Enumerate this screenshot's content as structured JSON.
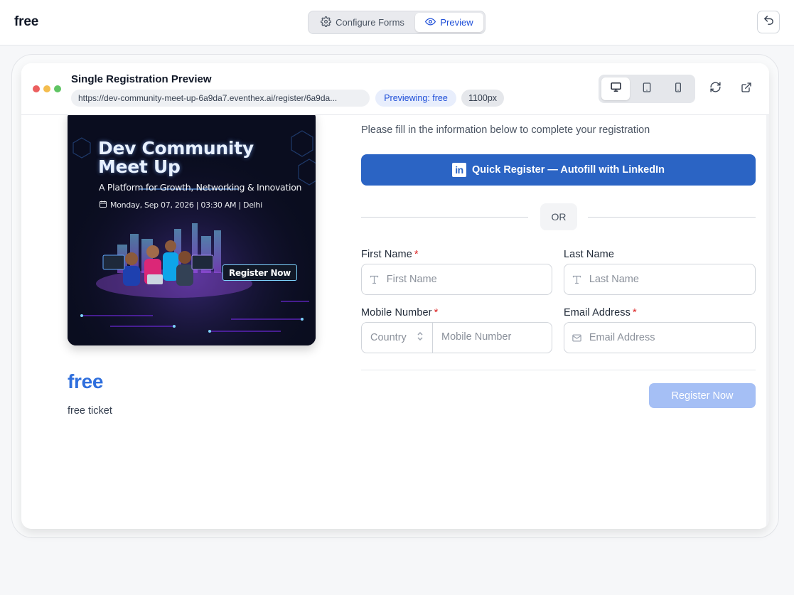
{
  "app": {
    "title": "free"
  },
  "mode_toggle": {
    "configure_label": "Configure Forms",
    "preview_label": "Preview",
    "active": "Preview"
  },
  "browser": {
    "title": "Single Registration Preview",
    "url": "https://dev-community-meet-up-6a9da7.eventhex.ai/register/6a9da...",
    "previewing_label": "Previewing: free",
    "width_label": "1100px",
    "dot_colors": [
      "#ec5f5f",
      "#f4bd4f",
      "#5fc463"
    ],
    "device_options": [
      "desktop-icon",
      "tablet-icon",
      "mobile-icon"
    ],
    "active_device": "desktop-icon"
  },
  "banner": {
    "title_line1": "Dev Community",
    "title_line2": "Meet Up",
    "subtitle": "A Platform for Growth, Networking & Innovation",
    "date_text": "Monday, Sep 07, 2026  | 03:30 AM  |  Delhi",
    "cta_label": "Register Now"
  },
  "ticket": {
    "name": "free",
    "description": "free ticket"
  },
  "form": {
    "intro": "Please fill in the information below to complete your registration",
    "linkedin_logo": "in",
    "linkedin_label": "Quick Register — Autofill with LinkedIn",
    "or_label": "OR",
    "first_name": {
      "label": "First Name",
      "required": "*",
      "placeholder": "First Name"
    },
    "last_name": {
      "label": "Last Name",
      "placeholder": "Last Name"
    },
    "mobile": {
      "label": "Mobile Number",
      "required": "*",
      "country_placeholder": "Country",
      "placeholder": "Mobile Number"
    },
    "email": {
      "label": "Email Address",
      "required": "*",
      "placeholder": "Email Address"
    },
    "submit_label": "Register Now"
  },
  "colors": {
    "accent": "#2b64c4",
    "ticket_title": "#2f6fdd",
    "submit_disabled": "#a5bff5",
    "required": "#dc2626"
  }
}
